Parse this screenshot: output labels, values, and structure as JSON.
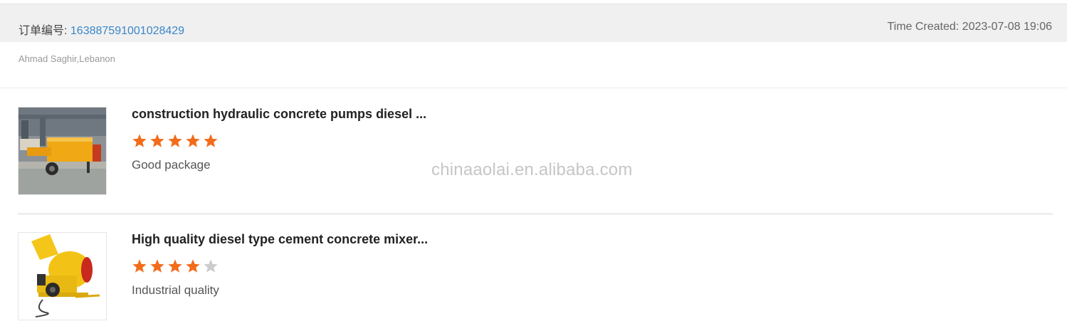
{
  "order": {
    "label": "订单编号: ",
    "number": "163887591001028429",
    "time_created": "Time Created: 2023-07-08 19:06"
  },
  "buyer": {
    "name_location": "Ahmad Saghir,Lebanon"
  },
  "reviews": [
    {
      "title": "construction hydraulic concrete pumps diesel ...",
      "rating": 5,
      "max_rating": 5,
      "comment": "Good package",
      "image_icon": "concrete-pump-product-image"
    },
    {
      "title": "High quality diesel type cement concrete mixer...",
      "rating": 4,
      "max_rating": 5,
      "comment": "Industrial quality",
      "image_icon": "concrete-mixer-product-image"
    }
  ],
  "watermark": "chinaaolai.en.alibaba.com",
  "colors": {
    "star_filled": "#f26c1b",
    "star_empty": "#cccccc",
    "link": "#3a87c8",
    "header_bg": "#f0f0f0"
  }
}
